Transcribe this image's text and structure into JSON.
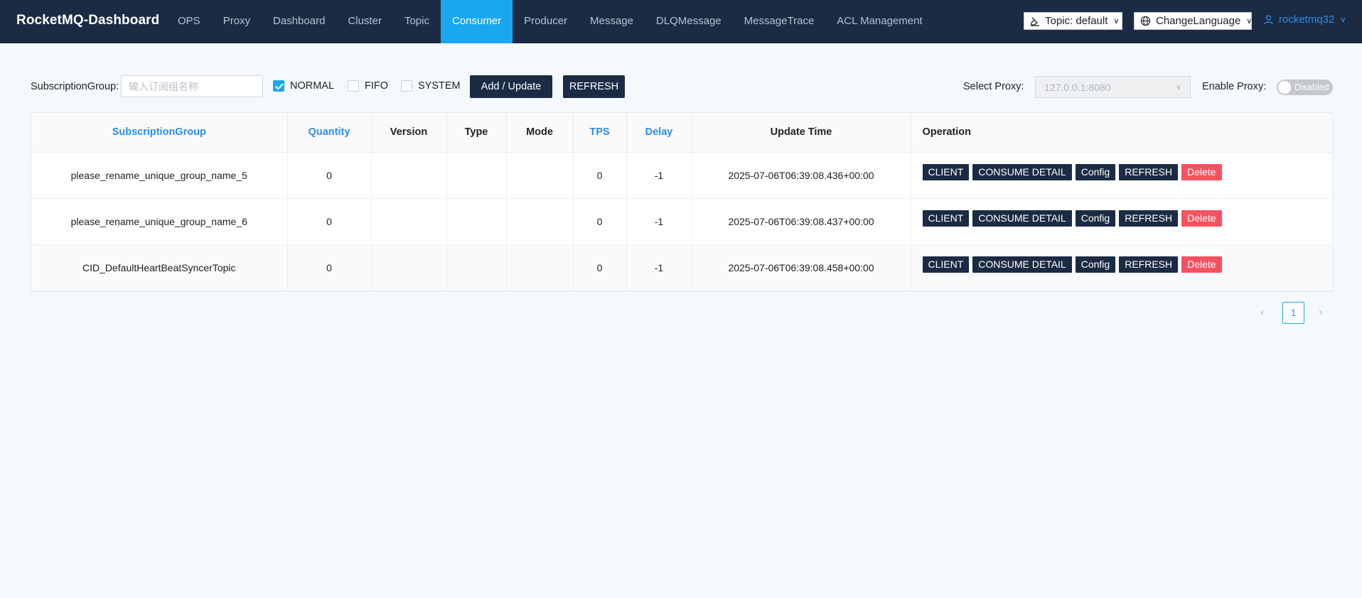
{
  "app": {
    "title": "RocketMQ-Dashboard"
  },
  "nav": {
    "items": [
      {
        "label": "OPS",
        "active": false
      },
      {
        "label": "Proxy",
        "active": false
      },
      {
        "label": "Dashboard",
        "active": false
      },
      {
        "label": "Cluster",
        "active": false
      },
      {
        "label": "Topic",
        "active": false
      },
      {
        "label": "Consumer",
        "active": true
      },
      {
        "label": "Producer",
        "active": false
      },
      {
        "label": "Message",
        "active": false
      },
      {
        "label": "DLQMessage",
        "active": false
      },
      {
        "label": "MessageTrace",
        "active": false
      },
      {
        "label": "ACL Management",
        "active": false
      }
    ],
    "topic_select": "Topic: default",
    "language_select": "ChangeLanguage",
    "user": "rocketmq32"
  },
  "toolbar": {
    "group_label": "SubscriptionGroup:",
    "group_placeholder": "输入订阅组名称",
    "group_value": "",
    "checkboxes": [
      {
        "label": "NORMAL",
        "checked": true
      },
      {
        "label": "FIFO",
        "checked": false
      },
      {
        "label": "SYSTEM",
        "checked": false
      }
    ],
    "add_update_label": "Add / Update",
    "refresh_label": "REFRESH",
    "proxy_label": "Select Proxy:",
    "proxy_value": "127.0.0.1:8080",
    "enable_proxy_label": "Enable Proxy:",
    "enable_proxy_state": "Disabled"
  },
  "table": {
    "columns": [
      "SubscriptionGroup",
      "Quantity",
      "Version",
      "Type",
      "Mode",
      "TPS",
      "Delay",
      "Update Time",
      "Operation"
    ],
    "rows": [
      {
        "group": "please_rename_unique_group_name_5",
        "quantity": "0",
        "version": "",
        "type": "",
        "mode": "",
        "tps": "0",
        "delay": "-1",
        "update_time": "2025-07-06T06:39:08.436+00:00"
      },
      {
        "group": "please_rename_unique_group_name_6",
        "quantity": "0",
        "version": "",
        "type": "",
        "mode": "",
        "tps": "0",
        "delay": "-1",
        "update_time": "2025-07-06T06:39:08.437+00:00"
      },
      {
        "group": "CID_DefaultHeartBeatSyncerTopic",
        "quantity": "0",
        "version": "",
        "type": "",
        "mode": "",
        "tps": "0",
        "delay": "-1",
        "update_time": "2025-07-06T06:39:08.458+00:00"
      }
    ],
    "operations": [
      "CLIENT",
      "CONSUME DETAIL",
      "Config",
      "REFRESH",
      "Delete"
    ]
  },
  "pagination": {
    "current_page": "1",
    "prev_icon": "chevron-left-icon",
    "next_icon": "chevron-right-icon"
  },
  "colors": {
    "nav_bg": "#1b2b44",
    "accent": "#1aa7f2",
    "link": "#2b8ee8",
    "danger": "#f5515f"
  }
}
